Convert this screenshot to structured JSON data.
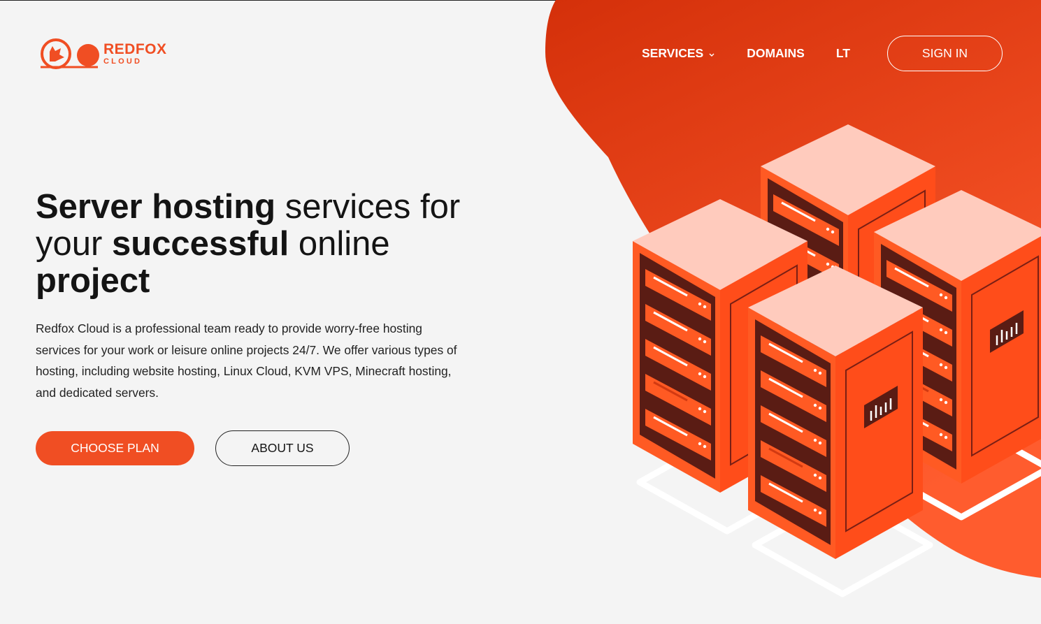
{
  "brand": {
    "name": "REDFOX",
    "sub": "CLOUD",
    "color": "#f04e23",
    "logo_icon": "fox-cloud-logo-icon"
  },
  "nav": {
    "items": [
      {
        "label": "SERVICES",
        "has_dropdown": true,
        "icon": "chevron-down-icon"
      },
      {
        "label": "DOMAINS"
      },
      {
        "label": "LT"
      }
    ],
    "sign_in": "SIGN IN"
  },
  "hero": {
    "title_parts": {
      "p1_bold": "Server hosting",
      "p2": " services for your ",
      "p3_bold": "successful",
      "p4": " online ",
      "p5_bold": "project"
    },
    "description": "Redfox Cloud is a professional team ready to provide worry-free hosting services for your work or leisure online projects 24/7. We offer various types of hosting, including website hosting, Linux Cloud, KVM VPS, Minecraft hosting, and dedicated servers.",
    "buttons": {
      "primary": "CHOOSE PLAN",
      "secondary": "ABOUT US"
    }
  },
  "colors": {
    "accent": "#f04e23",
    "background": "#f4f4f4",
    "blob_start": "#d4300a",
    "blob_end": "#ff5c2e"
  },
  "illustration": {
    "icon": "server-racks-illustration"
  }
}
